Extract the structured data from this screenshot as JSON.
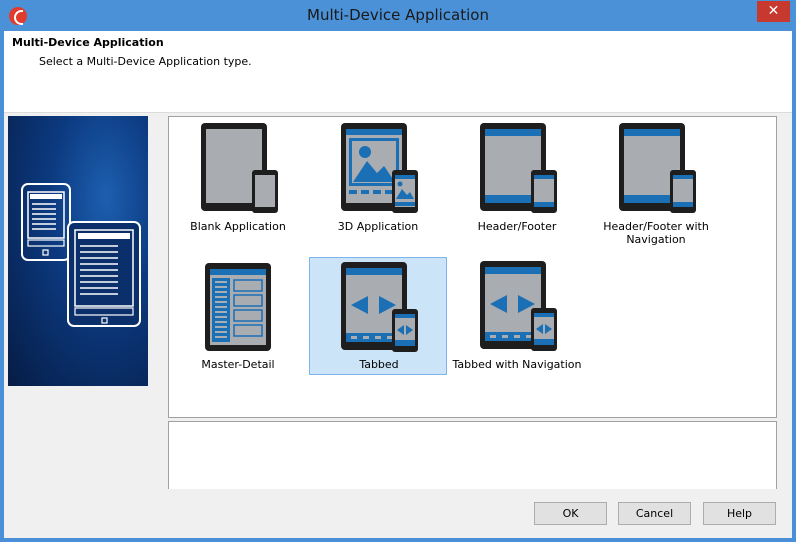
{
  "window": {
    "title": "Multi-Device Application",
    "close_glyph": "✕"
  },
  "header": {
    "title": "Multi-Device Application",
    "subtitle": "Select a Multi-Device Application type."
  },
  "templates": [
    {
      "label": "Blank Application",
      "icon": "blank-application-icon",
      "selected": false
    },
    {
      "label": "3D Application",
      "icon": "3d-application-icon",
      "selected": false
    },
    {
      "label": "Header/Footer",
      "icon": "header-footer-icon",
      "selected": false
    },
    {
      "label": "Header/Footer with Navigation",
      "icon": "header-footer-navigation-icon",
      "selected": false
    },
    {
      "label": "Master-Detail",
      "icon": "master-detail-icon",
      "selected": false
    },
    {
      "label": "Tabbed",
      "icon": "tabbed-icon",
      "selected": true
    },
    {
      "label": "Tabbed with Navigation",
      "icon": "tabbed-navigation-icon",
      "selected": false
    }
  ],
  "buttons": {
    "ok": "OK",
    "cancel": "Cancel",
    "help": "Help"
  },
  "colors": {
    "accent_blue": "#4b91d8",
    "selection": "#cce4f7",
    "device_blue": "#1a6fb5"
  }
}
